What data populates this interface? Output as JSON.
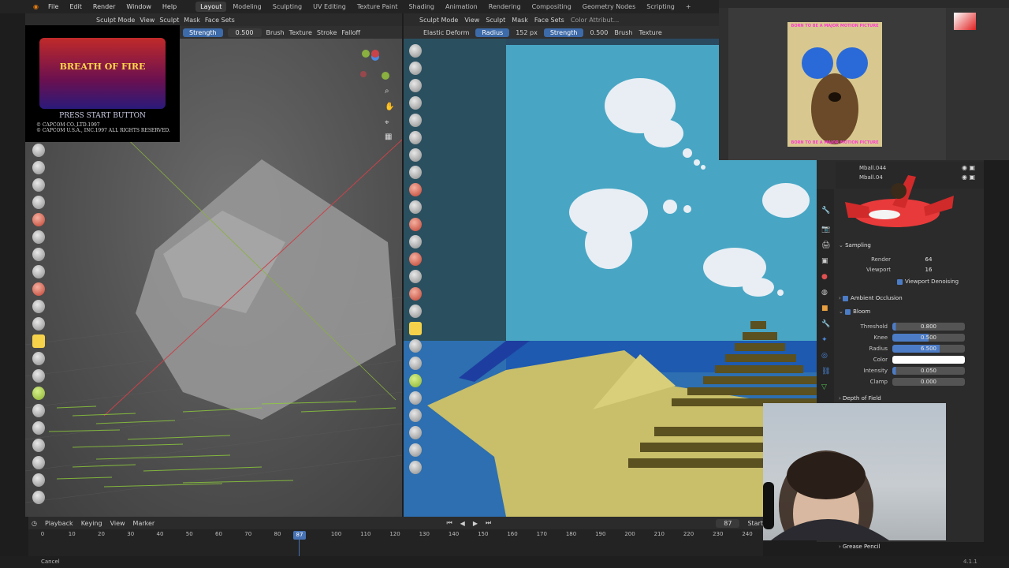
{
  "menubar": {
    "menus": [
      "File",
      "Edit",
      "Render",
      "Window",
      "Help"
    ],
    "workspaces": [
      "Layout",
      "Modeling",
      "Sculpting",
      "UV Editing",
      "Texture Paint",
      "Shading",
      "Animation",
      "Rendering",
      "Compositing",
      "Geometry Nodes",
      "Scripting"
    ],
    "active_workspace": "Layout",
    "add_tab": "+"
  },
  "left_viewport": {
    "header": {
      "mode": "Sculpt Mode",
      "view": "View",
      "sculpt": "Sculpt",
      "mask": "Mask",
      "face_sets": "Face Sets"
    },
    "tool": {
      "strength_label": "Strength",
      "strength_value": "0.500",
      "brush": "Brush",
      "texture": "Texture",
      "stroke": "Stroke",
      "falloff": "Falloff"
    }
  },
  "right_viewport": {
    "header": {
      "mode": "Sculpt Mode",
      "view": "View",
      "sculpt": "Sculpt",
      "mask": "Mask",
      "face_sets": "Face Sets",
      "attribute": "Color Attribut..."
    },
    "tool": {
      "brush_name": "Elastic Deform",
      "radius_label": "Radius",
      "radius_value": "152 px",
      "strength_label": "Strength",
      "strength_value": "0.500",
      "brush": "Brush",
      "texture": "Texture"
    }
  },
  "game_overlay": {
    "logo_text": "BREATH OF FIRE",
    "press_start": "PRESS START BUTTON",
    "copyright1": "© CAPCOM CO.,LTD.1997",
    "copyright2": "© CAPCOM U.S.A., INC.1997 ALL RIGHTS RESERVED."
  },
  "ps_overlay": {
    "top_text": "BORN TO BE A MAJOR MOTION PICTURE",
    "bottom_text": "BORN TO BE A MAJOR MOTION PICTURE"
  },
  "outliner": {
    "rows": [
      "Mball.044",
      "Mball.04"
    ]
  },
  "properties": {
    "sampling": {
      "header": "Sampling",
      "render_label": "Render",
      "render_value": "64",
      "viewport_label": "Viewport",
      "viewport_value": "16",
      "denoise_label": "Viewport Denoising"
    },
    "ambient_occlusion": "Ambient Occlusion",
    "bloom": {
      "header": "Bloom",
      "threshold_label": "Threshold",
      "threshold_value": "0.800",
      "threshold_fill": 0.05,
      "knee_label": "Knee",
      "knee_value": "0.500",
      "knee_fill": 0.5,
      "radius_label": "Radius",
      "radius_value": "6.500",
      "radius_fill": 0.65,
      "color_label": "Color",
      "color_value": "#ffffff",
      "intensity_label": "Intensity",
      "intensity_value": "0.050",
      "intensity_fill": 0.05,
      "clamp_label": "Clamp",
      "clamp_value": "0.000"
    },
    "depth_of_field": "Depth of Field",
    "grease_pencil": "Grease Pencil"
  },
  "timeline": {
    "playback": "Playback",
    "keying": "Keying",
    "view": "View",
    "marker": "Marker",
    "current_frame": "87",
    "start_label": "Start",
    "ticks": [
      0,
      10,
      20,
      30,
      40,
      50,
      60,
      70,
      80,
      90,
      100,
      110,
      120,
      130,
      140,
      150,
      160,
      170,
      180,
      190,
      200,
      210,
      220,
      230,
      240
    ],
    "playhead_label": "87"
  },
  "status": {
    "left": "Cancel",
    "version": "4.1.1"
  }
}
